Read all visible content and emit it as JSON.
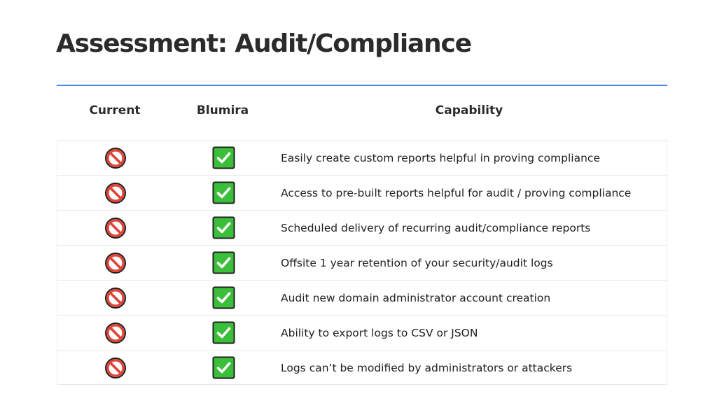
{
  "slide": {
    "title": "Assessment: Audit/Compliance"
  },
  "table": {
    "headers": {
      "current": "Current",
      "blumira": "Blumira",
      "capability": "Capability"
    },
    "rows": [
      {
        "current": "prohibited-icon",
        "blumira": "check-icon",
        "capability": "Easily create custom reports helpful in proving compliance"
      },
      {
        "current": "prohibited-icon",
        "blumira": "check-icon",
        "capability": "Access to pre-built reports helpful for audit / proving compliance"
      },
      {
        "current": "prohibited-icon",
        "blumira": "check-icon",
        "capability": "Scheduled delivery of recurring audit/compliance reports"
      },
      {
        "current": "prohibited-icon",
        "blumira": "check-icon",
        "capability": "Offsite 1 year retention of your security/audit logs"
      },
      {
        "current": "prohibited-icon",
        "blumira": "check-icon",
        "capability": "Audit new domain administrator account creation"
      },
      {
        "current": "prohibited-icon",
        "blumira": "check-icon",
        "capability": "Ability to export logs to CSV or JSON"
      },
      {
        "current": "prohibited-icon",
        "blumira": "check-icon",
        "capability": "Logs can’t be modified by administrators or attackers"
      }
    ]
  },
  "colors": {
    "accent_rule": "#4a86e8",
    "prohibited": "#e0453a",
    "check_fill": "#3bbf3b",
    "check_border": "#1f1f1f"
  }
}
